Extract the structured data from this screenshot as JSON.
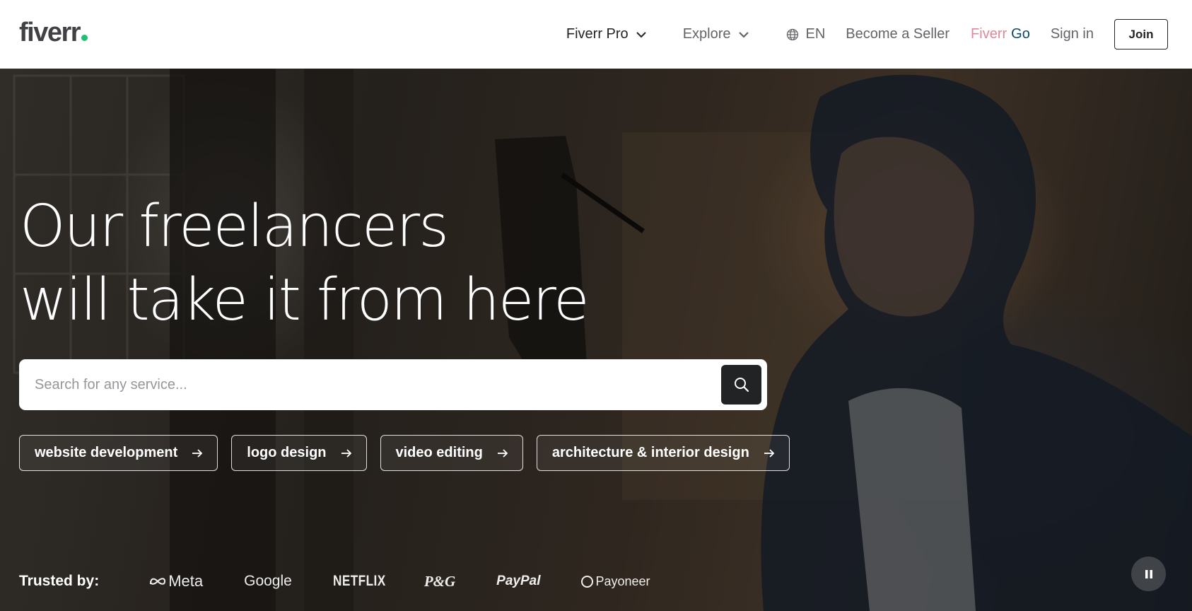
{
  "header": {
    "logo_text": "fiverr",
    "logo_dot_color": "#1dbf73",
    "nav": {
      "fiverr_pro": "Fiverr Pro",
      "explore": "Explore",
      "language": "EN",
      "become_seller": "Become a Seller",
      "fiverr_go_part1": "Fiverr",
      "fiverr_go_part2": "Go",
      "sign_in": "Sign in",
      "join": "Join"
    }
  },
  "hero": {
    "headline_line1": "Our freelancers",
    "headline_line2": "will take it from here",
    "search": {
      "placeholder": "Search for any service...",
      "value": ""
    },
    "suggestions": [
      {
        "label": "website development",
        "icon": "arrow-right-icon"
      },
      {
        "label": "logo design",
        "icon": "arrow-right-icon"
      },
      {
        "label": "video editing",
        "icon": "arrow-right-icon"
      },
      {
        "label": "architecture & interior design",
        "icon": "arrow-right-icon"
      }
    ],
    "trusted_by": {
      "label": "Trusted by:",
      "brands": [
        "Meta",
        "Google",
        "NETFLIX",
        "P&G",
        "PayPal",
        "Payoneer"
      ]
    },
    "video_control": "pause-icon"
  },
  "colors": {
    "brand_green": "#1dbf73",
    "dark_text": "#222325",
    "muted_text": "#62646a",
    "fiverr_go_pink": "#e0889b",
    "fiverr_go_teal": "#0d4a61"
  }
}
